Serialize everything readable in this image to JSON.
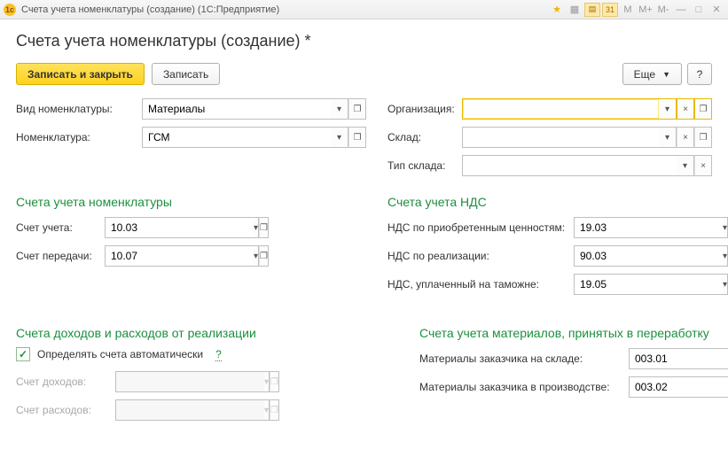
{
  "titlebar": {
    "icon_text": "1c",
    "title": "Счета учета номенклатуры (создание)  (1С:Предприятие)",
    "buttons": {
      "m": "M",
      "mplus": "M+",
      "mminus": "M-"
    }
  },
  "page_title": "Счета учета номенклатуры (создание) *",
  "toolbar": {
    "save_close": "Записать и закрыть",
    "save": "Записать",
    "more": "Еще",
    "help": "?"
  },
  "fields": {
    "nomenclature_type": {
      "label": "Вид номенклатуры:",
      "value": "Материалы"
    },
    "nomenclature": {
      "label": "Номенклатура:",
      "value": "ГСМ"
    },
    "organization": {
      "label": "Организация:",
      "value": ""
    },
    "warehouse": {
      "label": "Склад:",
      "value": ""
    },
    "warehouse_type": {
      "label": "Тип склада:",
      "value": ""
    }
  },
  "sections": {
    "nomenclature_accounts": "Счета учета номенклатуры",
    "vat_accounts": "Счета учета НДС",
    "income_expense": "Счета доходов и расходов от реализации",
    "processing_materials": "Счета учета материалов, принятых в переработку"
  },
  "accounts": {
    "account": {
      "label": "Счет учета:",
      "value": "10.03"
    },
    "transfer_account": {
      "label": "Счет передачи:",
      "value": "10.07"
    },
    "vat_purchase": {
      "label": "НДС по приобретенным ценностям:",
      "value": "19.03"
    },
    "vat_sale": {
      "label": "НДС по реализации:",
      "value": "90.03"
    },
    "vat_customs": {
      "label": "НДС, уплаченный на таможне:",
      "value": "19.05"
    }
  },
  "income_expense": {
    "auto_checkbox_label": "Определять счета автоматически",
    "auto_checked": true,
    "help": "?",
    "income": {
      "label": "Счет доходов:",
      "value": ""
    },
    "expense": {
      "label": "Счет расходов:",
      "value": ""
    }
  },
  "processing": {
    "customer_warehouse": {
      "label": "Материалы заказчика на складе:",
      "value": "003.01"
    },
    "customer_production": {
      "label": "Материалы заказчика в производстве:",
      "value": "003.02"
    }
  },
  "glyphs": {
    "dropdown": "▾",
    "open": "❐",
    "clear": "×"
  }
}
